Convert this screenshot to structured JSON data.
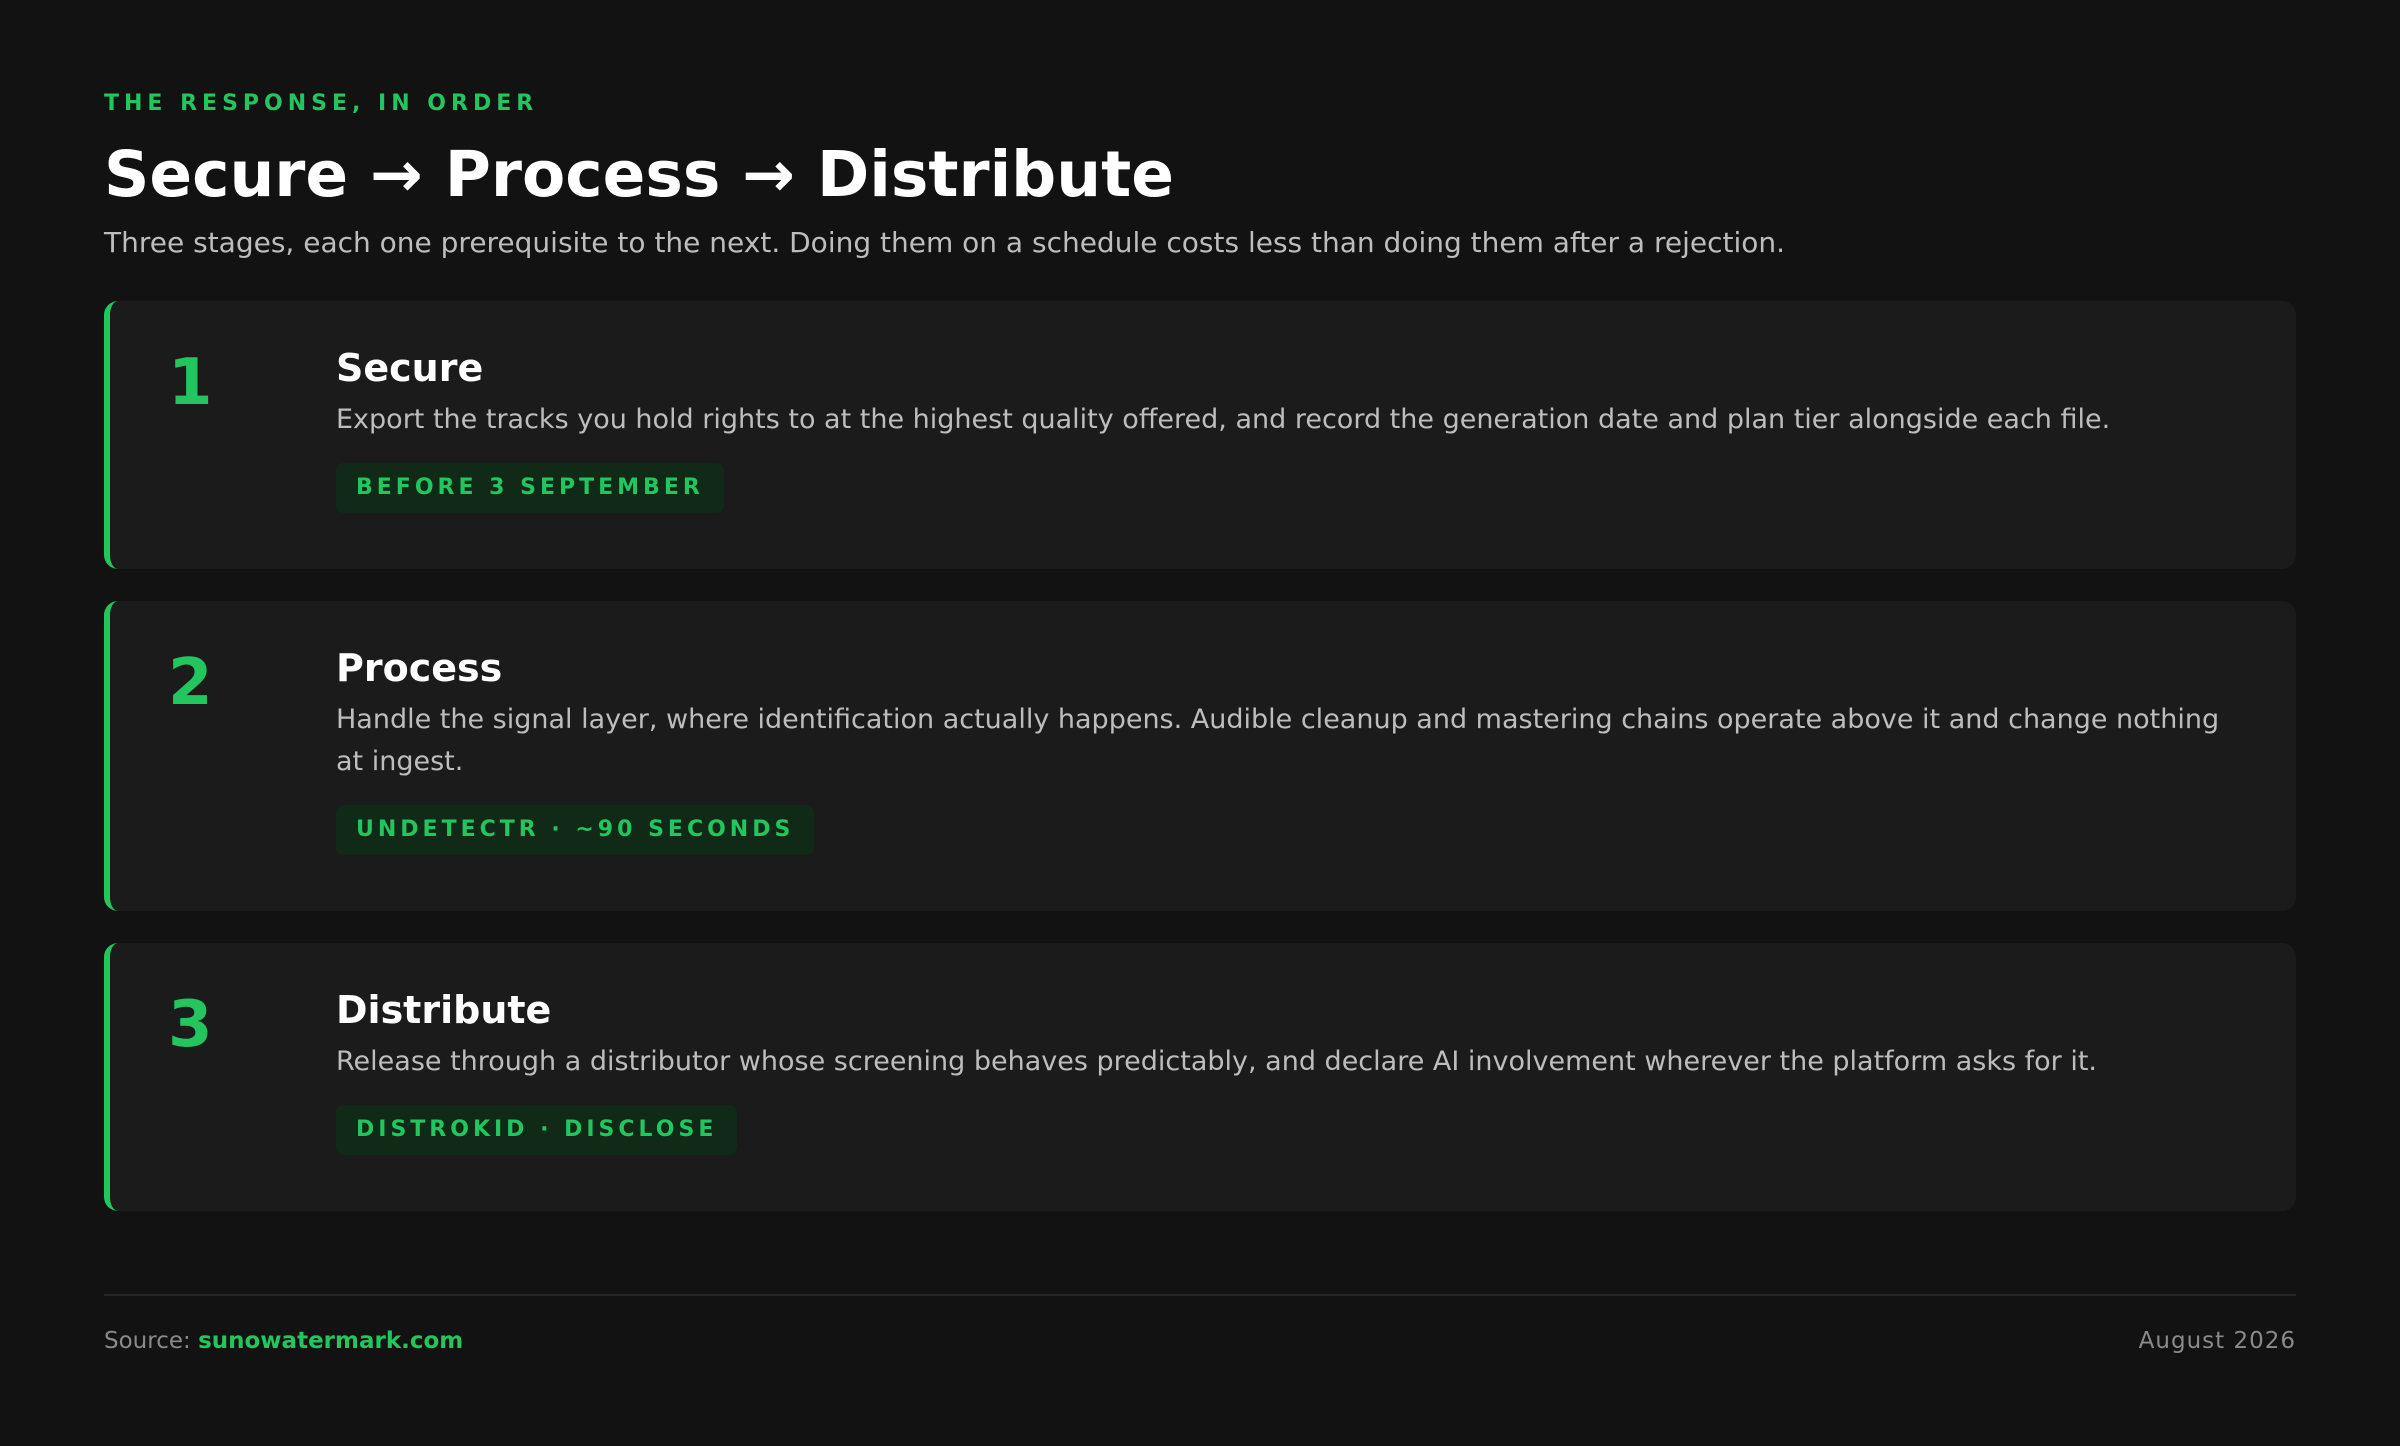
{
  "eyebrow": "THE RESPONSE, IN ORDER",
  "title": "Secure → Process → Distribute",
  "subtitle": "Three stages, each one prerequisite to the next. Doing them on a schedule costs less than doing them after a rejection.",
  "steps": [
    {
      "number": "1",
      "title": "Secure",
      "description": "Export the tracks you hold rights to at the highest quality offered, and record the generation date and plan tier alongside each file.",
      "tag": "BEFORE 3 SEPTEMBER"
    },
    {
      "number": "2",
      "title": "Process",
      "description": "Handle the signal layer, where identification actually happens. Audible cleanup and mastering chains operate above it and change nothing at ingest.",
      "tag": "UNDETECTR · ~90 SECONDS"
    },
    {
      "number": "3",
      "title": "Distribute",
      "description": "Release through a distributor whose screening behaves predictably, and declare AI involvement wherever the platform asks for it.",
      "tag": "DISTROKID · DISCLOSE"
    }
  ],
  "footer": {
    "source_label": "Source:",
    "source_link": "sunowatermark.com",
    "date": "August 2026"
  },
  "colors": {
    "accent": "#22c55e",
    "background": "#121212",
    "card": "#1b1b1b"
  }
}
